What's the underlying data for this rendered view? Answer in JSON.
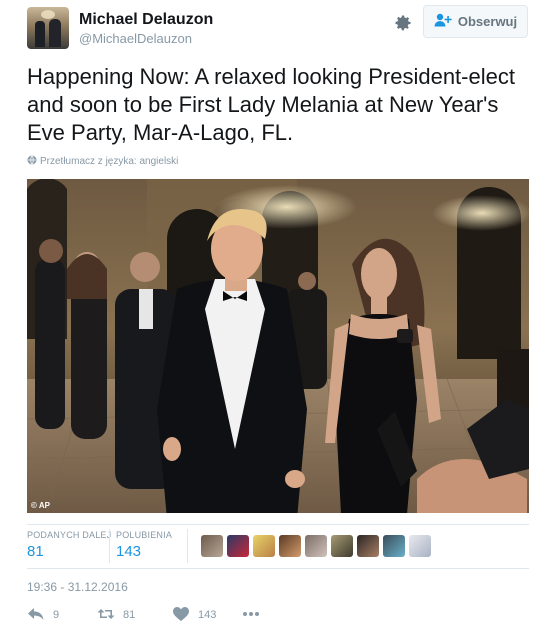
{
  "user": {
    "name": "Michael Delauzon",
    "handle": "@MichaelDelauzon"
  },
  "header": {
    "follow_label": "Obserwuj"
  },
  "tweet": {
    "text": "Happening Now: A relaxed looking President-elect and soon to be First Lady Melania at New Year's Eve Party, Mar-A-Lago, FL.",
    "translate_label": "Przetłumacz z języka: angielski",
    "photo_credit": "© AP",
    "timestamp": "19:36 - 31.12.2016"
  },
  "stats": {
    "retweets_label": "PODANYCH DALEJ",
    "retweets_value": "81",
    "likes_label": "POLUBIENIA",
    "likes_value": "143"
  },
  "actions": {
    "reply_count": "9",
    "retweet_count": "81",
    "like_count": "143"
  },
  "icons": {
    "settings": "gear-icon",
    "follow": "add-user-icon",
    "translate": "globe-icon",
    "reply": "reply-icon",
    "retweet": "retweet-icon",
    "like": "heart-icon",
    "more": "more-icon"
  },
  "colors": {
    "link": "#1b95e0",
    "muted": "#8899a6",
    "text": "#14171a"
  }
}
